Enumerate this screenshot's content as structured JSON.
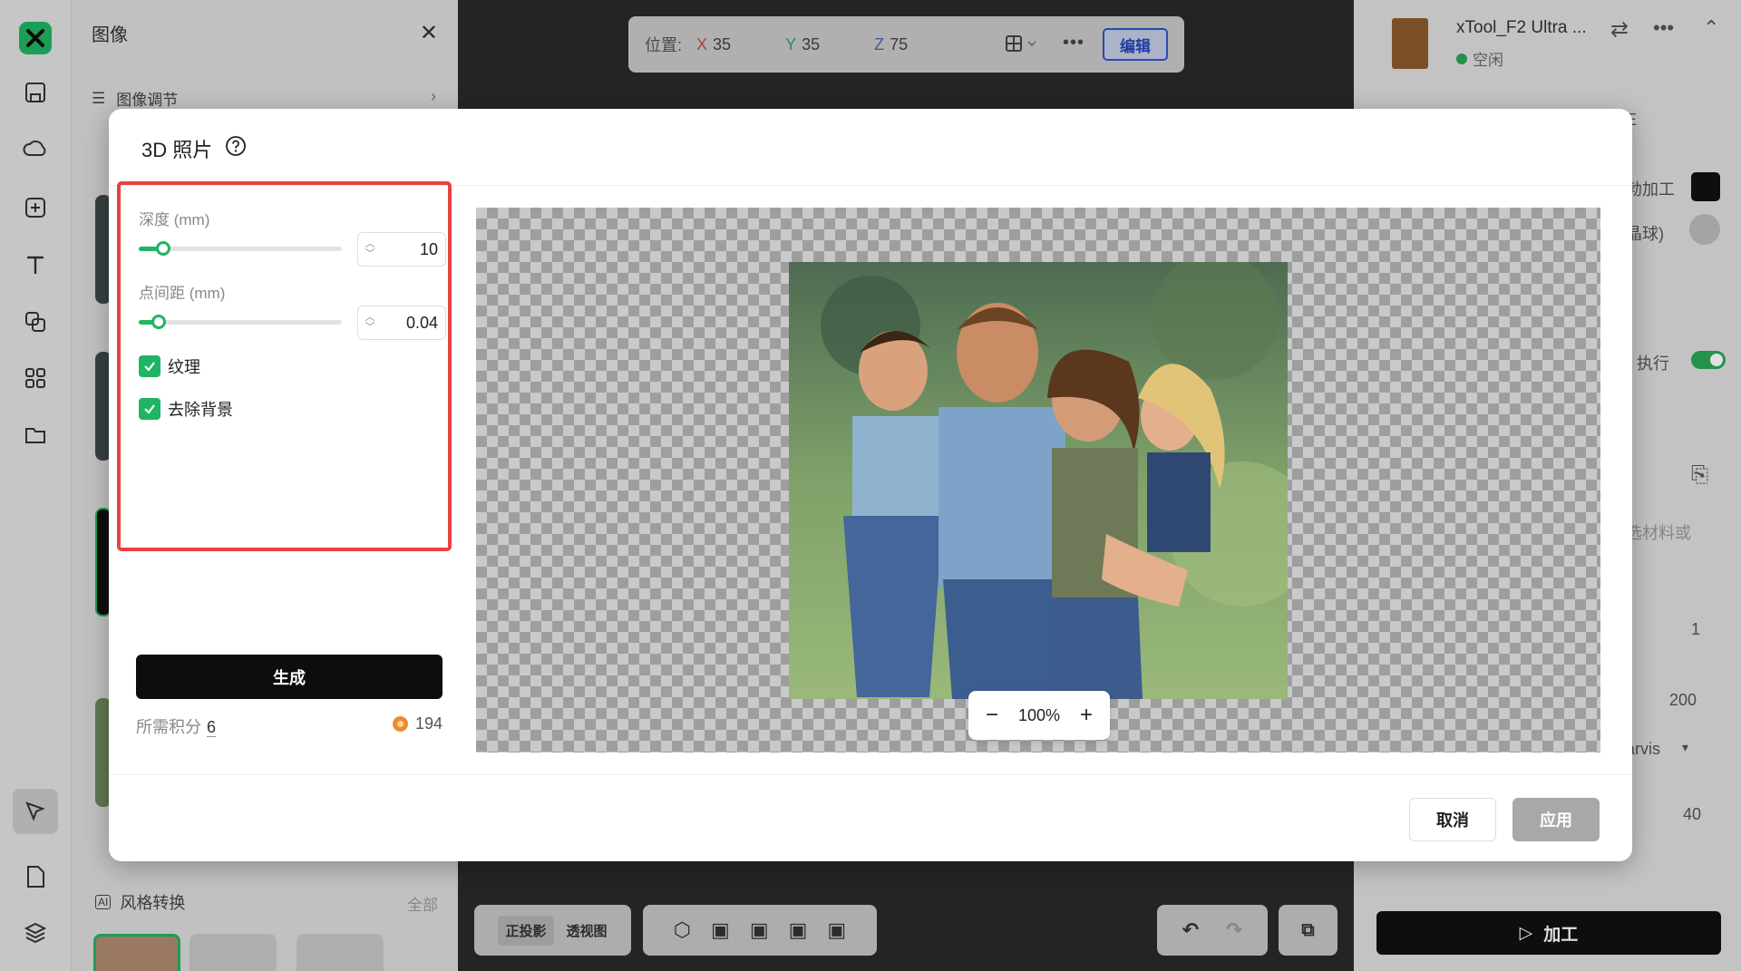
{
  "left_panel": {
    "title": "图像",
    "adjust_label": "图像调节",
    "style_title": "风格转换",
    "style_all": "全部"
  },
  "topbar": {
    "position_label": "位置:",
    "x_axis": "X",
    "x_value": "35",
    "y_axis": "Y",
    "y_value": "35",
    "z_axis": "Z",
    "z_value": "75",
    "edit_label": "编辑"
  },
  "right_panel": {
    "machine_name": "xTool_F2 Ultra ...",
    "machine_status": "空闲",
    "frag_e": "E",
    "frag_process": "勃加工",
    "frag_crystal": "晶球)",
    "frag_execute": "执行",
    "frag_material": "选材料或",
    "val_1": "1",
    "val_200": "200",
    "frag_jarvis": "arvis",
    "val_40": "40",
    "process_label": "加工"
  },
  "bottom_toolbar": {
    "ortho_label": "正投影",
    "persp_label": "透视图"
  },
  "modal": {
    "title": "3D 照片",
    "depth_label": "深度 (mm)",
    "depth_value": "10",
    "depth_fraction": 0.12,
    "spacing_label": "点间距 (mm)",
    "spacing_value": "0.04",
    "spacing_fraction": 0.1,
    "texture_label": "纹理",
    "texture_checked": true,
    "remove_bg_label": "去除背景",
    "remove_bg_checked": true,
    "generate_label": "生成",
    "points_label": "所需积分",
    "points_cost": "6",
    "points_balance": "194",
    "zoom_value": "100%",
    "cancel_label": "取消",
    "apply_label": "应用"
  },
  "colors": {
    "accent": "#1fb564",
    "highlight_border": "#e8423f",
    "edit_blue": "#2346b4",
    "coin": "#f08a2c"
  }
}
